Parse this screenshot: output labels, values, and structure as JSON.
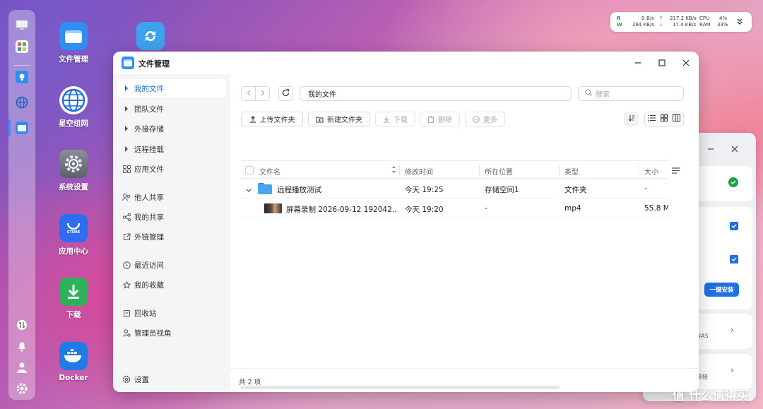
{
  "desktop": {
    "icons": [
      {
        "label": "文件管理"
      },
      {
        "label": ""
      },
      {
        "label": "星空组网"
      },
      {
        "label": "系统设置"
      },
      {
        "label": "应用中心",
        "badge": "STORE"
      },
      {
        "label": "下载"
      },
      {
        "label": "Docker"
      }
    ]
  },
  "stats": {
    "r_label": "R",
    "w_label": "W",
    "r_disk": "0",
    "r_disk_unit": "B/s",
    "w_disk": "264 KB/s",
    "up": "217.2 KB/s",
    "down": "17.4 KB/s",
    "cpu_label": "CPU",
    "cpu_value": "4%",
    "ram_label": "RAM",
    "ram_value": "33%"
  },
  "window": {
    "title": "文件管理",
    "sidebar": {
      "groups": [
        [
          {
            "label": "我的文件",
            "active": true,
            "icon": "caret-right-icon"
          },
          {
            "label": "团队文件",
            "icon": "caret-right-icon"
          },
          {
            "label": "外接存储",
            "icon": "caret-right-icon"
          },
          {
            "label": "远程挂载",
            "icon": "caret-right-icon"
          },
          {
            "label": "应用文件",
            "icon": "grid-icon"
          }
        ],
        [
          {
            "label": "他人共享",
            "icon": "users-icon"
          },
          {
            "label": "我的共享",
            "icon": "share-icon"
          },
          {
            "label": "外链管理",
            "icon": "external-link-icon"
          }
        ],
        [
          {
            "label": "最近访问",
            "icon": "clock-icon"
          },
          {
            "label": "我的收藏",
            "icon": "star-icon"
          }
        ],
        [
          {
            "label": "回收站",
            "icon": "trash-icon"
          },
          {
            "label": "管理员视角",
            "icon": "admin-icon"
          }
        ]
      ],
      "settings_label": "设置"
    },
    "path": "我的文件",
    "search_placeholder": "搜索",
    "toolbar": {
      "upload": "上传文件夹",
      "new_folder": "新建文件夹",
      "download": "下载",
      "delete": "删除",
      "more": "更多"
    },
    "columns": [
      "文件名",
      "修改时间",
      "所在位置",
      "类型",
      "大小"
    ],
    "rows": [
      {
        "name": "远程播放测试",
        "modified": "今天 19:25",
        "location": "存储空间1",
        "type": "文件夹",
        "size": "-",
        "kind": "folder"
      },
      {
        "name": "屏幕录制 2026-09-12 192042....",
        "modified": "今天 19:20",
        "location": "-",
        "type": "mp4",
        "size": "55.8 M",
        "kind": "video"
      }
    ],
    "footer_count": "共 2 项"
  },
  "background_panel": {
    "install_button": "一键安装",
    "text1": "NAS",
    "text2": "链接"
  },
  "watermark": "值 什么值得买",
  "colors": {
    "accent": "#1f6fe5",
    "folder": "#4aa3f0",
    "green": "#1aa34a"
  }
}
